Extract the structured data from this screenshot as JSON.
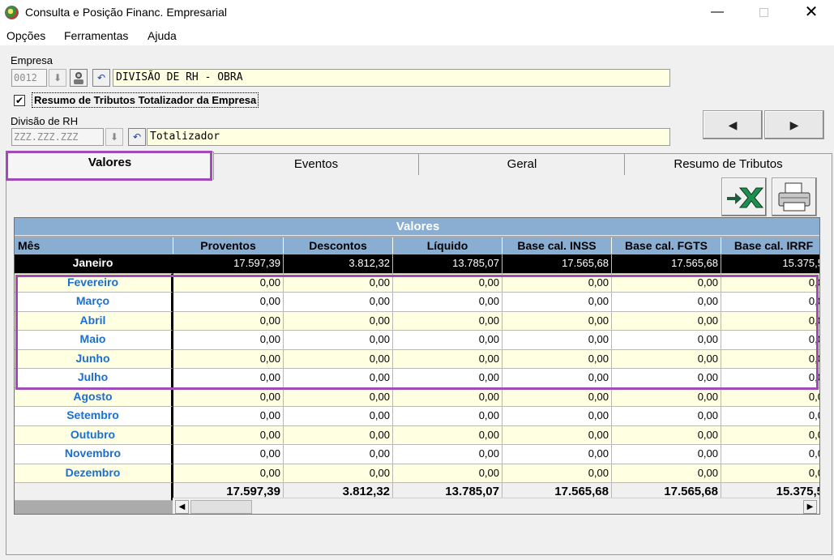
{
  "window": {
    "title": "Consulta e Posição Financ. Empresarial",
    "min": "—",
    "close": "✕"
  },
  "menu": [
    "Opções",
    "Ferramentas",
    "Ajuda"
  ],
  "empresa": {
    "label": "Empresa",
    "code": "0012",
    "name": "DIVISÃO DE RH - OBRA"
  },
  "resumo": {
    "checked": "✔",
    "label": "Resumo de Tributos Totalizador da Empresa"
  },
  "divisao": {
    "label": "Divisão de RH",
    "code": "ZZZ.ZZZ.ZZZ",
    "name": "Totalizador"
  },
  "nav": {
    "prev": "◀",
    "next": "▶"
  },
  "tabs": [
    "Valores",
    "Eventos",
    "Geral",
    "Resumo de Tributos"
  ],
  "grid": {
    "title": "Valores",
    "columns": [
      "Mês",
      "Proventos",
      "Descontos",
      "Líquido",
      "Base cal. INSS",
      "Base cal. FGTS",
      "Base cal. IRRF"
    ],
    "rows": [
      [
        "Janeiro",
        "17.597,39",
        "3.812,32",
        "13.785,07",
        "17.565,68",
        "17.565,68",
        "15.375,5"
      ],
      [
        "Fevereiro",
        "0,00",
        "0,00",
        "0,00",
        "0,00",
        "0,00",
        "0,0"
      ],
      [
        "Março",
        "0,00",
        "0,00",
        "0,00",
        "0,00",
        "0,00",
        "0,0"
      ],
      [
        "Abril",
        "0,00",
        "0,00",
        "0,00",
        "0,00",
        "0,00",
        "0,0"
      ],
      [
        "Maio",
        "0,00",
        "0,00",
        "0,00",
        "0,00",
        "0,00",
        "0,0"
      ],
      [
        "Junho",
        "0,00",
        "0,00",
        "0,00",
        "0,00",
        "0,00",
        "0,0"
      ],
      [
        "Julho",
        "0,00",
        "0,00",
        "0,00",
        "0,00",
        "0,00",
        "0,0"
      ],
      [
        "Agosto",
        "0,00",
        "0,00",
        "0,00",
        "0,00",
        "0,00",
        "0,0"
      ],
      [
        "Setembro",
        "0,00",
        "0,00",
        "0,00",
        "0,00",
        "0,00",
        "0,0"
      ],
      [
        "Outubro",
        "0,00",
        "0,00",
        "0,00",
        "0,00",
        "0,00",
        "0,0"
      ],
      [
        "Novembro",
        "0,00",
        "0,00",
        "0,00",
        "0,00",
        "0,00",
        "0,0"
      ],
      [
        "Dezembro",
        "0,00",
        "0,00",
        "0,00",
        "0,00",
        "0,00",
        "0,0"
      ]
    ],
    "totals": [
      "",
      "17.597,39",
      "3.812,32",
      "13.785,07",
      "17.565,68",
      "17.565,68",
      "15.375,5"
    ]
  },
  "scroll": {
    "left": "◀",
    "right": "▶"
  }
}
